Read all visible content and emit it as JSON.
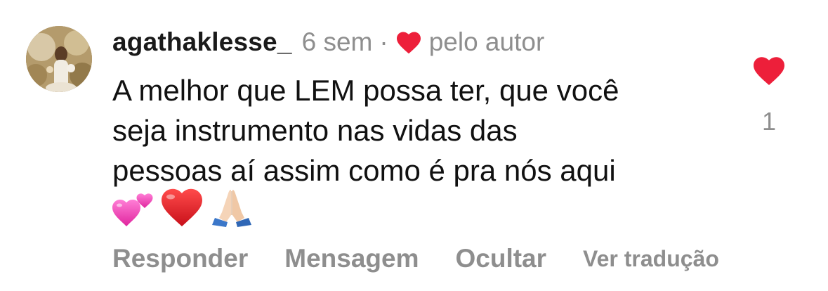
{
  "comment": {
    "username": "agathaklesse_",
    "time_ago": "6 sem",
    "separator": "·",
    "liked_by_author_label": "pelo autor",
    "body_lines": [
      "A melhor que LEM possa ter, que você",
      "seja instrumento nas vidas das",
      "pessoas aí assim como é pra nós aqui"
    ],
    "emojis": [
      "two-hearts",
      "red-heart",
      "folded-hands"
    ],
    "like_count": "1",
    "actions": {
      "reply": "Responder",
      "message": "Mensagem",
      "hide": "Ocultar",
      "translate": "Ver tradução"
    }
  },
  "colors": {
    "heart_red": "#ed1f3a",
    "meta_gray": "#8e8e8e",
    "text_dark": "#111111"
  }
}
